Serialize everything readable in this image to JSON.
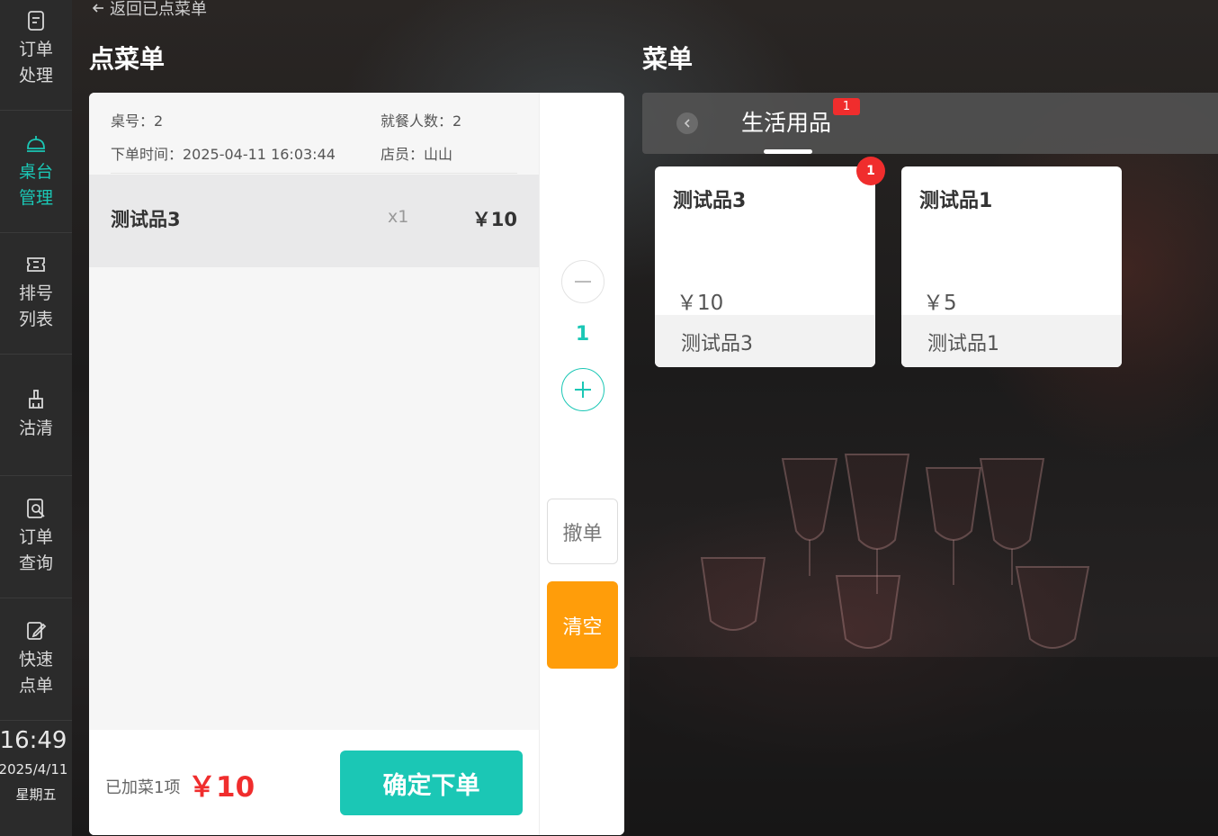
{
  "sidebar": {
    "items": [
      {
        "label": "订单处理",
        "icon": "document-icon",
        "active": false
      },
      {
        "label": "桌台管理",
        "icon": "service-bell-icon",
        "active": true
      },
      {
        "label": "排号列表",
        "icon": "ticket-icon",
        "active": false
      },
      {
        "label": "沽清",
        "icon": "broom-icon",
        "active": false
      },
      {
        "label": "订单查询",
        "icon": "order-search-icon",
        "active": false
      },
      {
        "label": "快速点单",
        "icon": "quick-order-icon",
        "active": false
      }
    ],
    "clock": {
      "time": "16:49",
      "date": "2025/4/11",
      "weekday": "星期五"
    }
  },
  "header": {
    "back_label": "返回已点菜单",
    "order_title": "点菜单",
    "menu_title": "菜单"
  },
  "order": {
    "table_label": "桌号：2",
    "guests_label": "就餐人数：2",
    "time_label": "下单时间：2025-04-11 16:03:44",
    "staff_label": "店员：山山",
    "items": [
      {
        "name": "测试品3",
        "qty": "x1",
        "price": "￥10"
      }
    ],
    "count": "1",
    "summary": "已加菜1项",
    "total": "￥10",
    "confirm_label": "确定下单",
    "undo_label": "撤单",
    "clear_label": "清空"
  },
  "menu": {
    "tabs": [
      {
        "label": "生活用品",
        "badge": "1"
      }
    ],
    "products": [
      {
        "name": "测试品3",
        "price": "￥10",
        "subtitle": "测试品3",
        "badge": "1"
      },
      {
        "name": "测试品1",
        "price": "￥5",
        "subtitle": "测试品1",
        "badge": ""
      }
    ]
  },
  "colors": {
    "accent": "#1bc7b5",
    "danger": "#f02d2d",
    "warning": "#ff9d0a",
    "sidebar": "#2b2b2b"
  }
}
